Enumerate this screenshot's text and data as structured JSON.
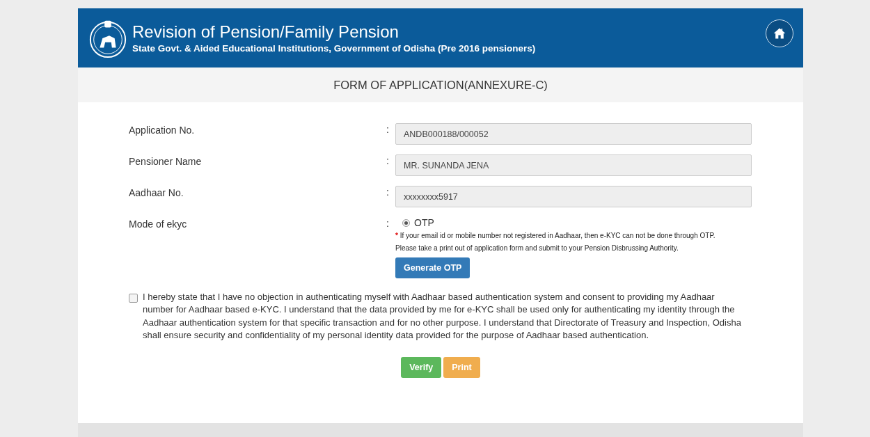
{
  "header": {
    "title": "Revision of Pension/Family Pension",
    "subtitle": "State Govt. & Aided Educational Institutions, Government of Odisha (Pre 2016 pensioners)"
  },
  "form_title": "FORM OF APPLICATION(ANNEXURE-C)",
  "fields": [
    {
      "kind": "text",
      "label": "Application No.",
      "separator": ":",
      "value": "ANDB000188/000052"
    },
    {
      "kind": "text",
      "label": "Pensioner Name",
      "separator": ":",
      "value": "MR. SUNANDA JENA"
    },
    {
      "kind": "text",
      "label": "Aadhaar No.",
      "separator": ":",
      "value": "xxxxxxxx5917"
    },
    {
      "kind": "radio",
      "label": "Mode of ekyc",
      "separator": ":",
      "option": "OTP",
      "selected": true,
      "note_mark": "*",
      "note": "If your email id or mobile number not registered in Aadhaar, then e-KYC can not be done through OTP.",
      "note2": "Please take a print out of application form and submit to your Pension Disbrussing Authority.",
      "button": "Generate OTP"
    }
  ],
  "declaration": {
    "checked": false,
    "text": "I hereby state that I have no objection in authenticating myself with Aadhaar based authentication system and consent to providing my Aadhaar number for Aadhaar based e-KYC. I understand that the data provided by me for e-KYC shall be used only for authenticating my identity through the Aadhaar authentication system for that specific transaction and for no other purpose. I understand that Directorate of Treasury and Inspection, Odisha shall ensure security and confidentiality of my personal identity data provided for the purpose of Aadhaar based authentication."
  },
  "buttons": [
    {
      "kind": "success",
      "label": "Verify"
    },
    {
      "kind": "warning",
      "label": "Print"
    }
  ]
}
